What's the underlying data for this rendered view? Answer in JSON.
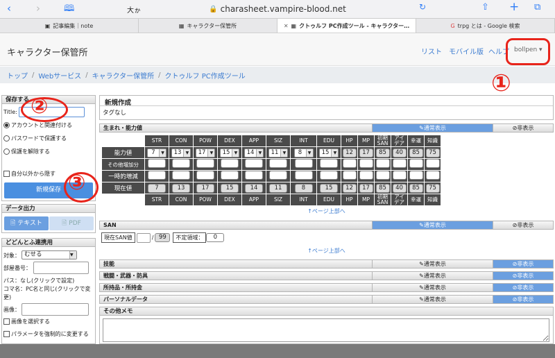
{
  "browser": {
    "text_size": "大ゕ",
    "url": "charasheet.vampire-blood.net",
    "tabs": [
      {
        "label": "記事編集｜note"
      },
      {
        "label": "キャラクター保管所"
      },
      {
        "label": "クトゥルフ PC作成ツール - キャラクター…"
      },
      {
        "label": "trpg とは - Google 検索"
      }
    ]
  },
  "header": {
    "site_title": "キャラクター保管所",
    "links": [
      "リスト",
      "モバイル版",
      "ヘルプ"
    ],
    "user": "bollpen ▾"
  },
  "breadcrumb": [
    "トップ",
    "Webサービス",
    "キャラクター保管所",
    "クトゥルフ PC作成ツール"
  ],
  "save_panel": {
    "title": "保存する",
    "title_label": "Title:",
    "title_value": "",
    "options": [
      "アカウントと関連付ける",
      "パスワードで保護する",
      "保護を解除する"
    ],
    "hide_label": "自分以外から隠す",
    "submit": "新規保存"
  },
  "export_panel": {
    "title": "データ出力",
    "text_btn": "テキスト",
    "pdf_btn": "PDF"
  },
  "dodontof_panel": {
    "title": "どどんとふ連携用",
    "target_label": "対象：",
    "target_value": "むせる",
    "room_label": "部屋番号：",
    "pass_label": "パス：なし(クリックで設定)",
    "koma_label": "コマ名：PC名と同じ(クリックで変更)",
    "image_label": "画像：",
    "image_select": "画像を選択する",
    "force_param": "パラメータを強制的に変更する"
  },
  "main": {
    "new_title": "新規作成",
    "tag": "タグなし",
    "sections": [
      {
        "title": "生まれ・能力値",
        "normal": "✎通常表示",
        "hide": "⊘非表示",
        "active": "normal"
      },
      {
        "title": "SAN",
        "normal": "✎通常表示",
        "hide": "⊘非表示",
        "active": "normal"
      },
      {
        "title": "技能",
        "normal": "✎通常表示",
        "hide": "⊘非表示",
        "active": "hide"
      },
      {
        "title": "戦闘・武器・防具",
        "normal": "✎通常表示",
        "hide": "⊘非表示",
        "active": "hide"
      },
      {
        "title": "所持品・所持金",
        "normal": "✎通常表示",
        "hide": "⊘非表示",
        "active": "hide"
      },
      {
        "title": "パーソナルデータ",
        "normal": "✎通常表示",
        "hide": "⊘非表示",
        "active": "hide"
      }
    ],
    "other_memo": "その他メモ",
    "page_top": "↑ページ上部へ",
    "stats": {
      "headers": [
        "STR",
        "CON",
        "POW",
        "DEX",
        "APP",
        "SIZ",
        "INT",
        "EDU",
        "HP",
        "MP",
        "初期\nSAN",
        "アイ\nデア",
        "幸運",
        "知識"
      ],
      "row_labels": [
        "能力値",
        "その他増加分",
        "一時的増減",
        "現在値"
      ],
      "ability": [
        "7",
        "13",
        "17",
        "15",
        "14",
        "11",
        "8",
        "15",
        "12",
        "17",
        "85",
        "40",
        "85",
        "75"
      ],
      "current": [
        "7",
        "13",
        "17",
        "15",
        "14",
        "11",
        "8",
        "15",
        "12",
        "17",
        "85",
        "40",
        "85",
        "75"
      ]
    },
    "san": {
      "current_label": "現在SAN値",
      "current_value": "",
      "max": "99",
      "indef_label": "不定領域：",
      "indef_value": "0"
    }
  },
  "annotations": {
    "one": "①",
    "two": "②",
    "three": "③"
  }
}
